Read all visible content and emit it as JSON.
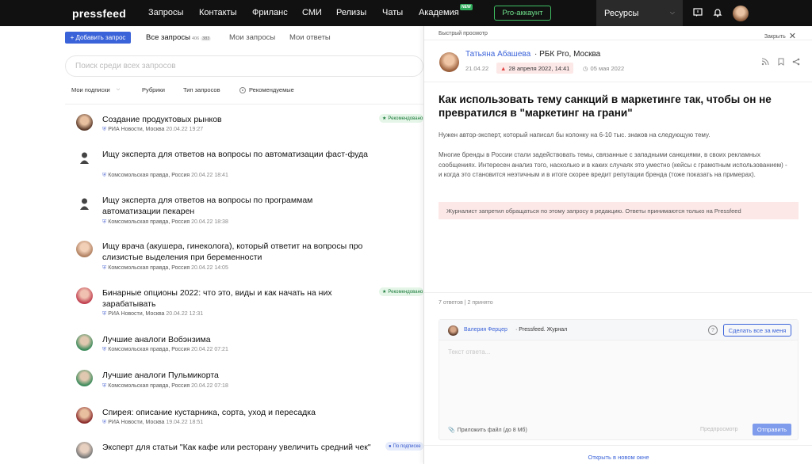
{
  "topbar": {
    "logo": "pressfeed",
    "nav": [
      "Запросы",
      "Контакты",
      "Фриланс",
      "СМИ",
      "Релизы",
      "Чаты",
      "Академия"
    ],
    "new_badge": "NEW",
    "pro_label": "Pro-аккаунт",
    "resources_label": "Ресурсы"
  },
  "left": {
    "add_button": "+ Добавить запрос",
    "tabs": [
      {
        "label": "Все запросы",
        "count_a": "406",
        "count_b": "383"
      },
      {
        "label": "Мои запросы"
      },
      {
        "label": "Мои ответы"
      }
    ],
    "search_placeholder": "Поиск среди всех запросов",
    "filters": [
      "Мои подписки",
      "Рубрики",
      "Тип запросов",
      "Рекомендуемые"
    ],
    "items": [
      {
        "title": "Создание продуктовых рынков",
        "source": "РИА Новости, Москва",
        "date": "20.04.22 19:27",
        "badge": "Рекомендовано"
      },
      {
        "title": "Ищу эксперта для ответов на вопросы по автоматизации фаст-фуда",
        "source": "Комсомольская правда, Россия",
        "date": "20.04.22 18:41"
      },
      {
        "title": "Ищу эксперта для ответов на вопросы по программам автоматизации пекарен",
        "source": "Комсомольская правда, Россия",
        "date": "20.04.22 18:38"
      },
      {
        "title": "Ищу врача (акушера, гинеколога), который ответит на вопросы про слизистые выделения при беременности",
        "source": "Комсомольская правда, Россия",
        "date": "20.04.22 14:05"
      },
      {
        "title": "Бинарные опционы 2022: что это, виды и как начать на них зарабатывать",
        "source": "РИА Новости, Москва",
        "date": "20.04.22 12:31",
        "badge": "Рекомендовано"
      },
      {
        "title": "Лучшие аналоги Вобэнзима",
        "source": "Комсомольская правда, Россия",
        "date": "20.04.22 07:21"
      },
      {
        "title": "Лучшие аналоги Пульмикорта",
        "source": "Комсомольская правда, Россия",
        "date": "20.04.22 07:18"
      },
      {
        "title": "Спирея: описание кустарника, сорта, уход и пересадка",
        "source": "РИА Новости, Москва",
        "date": "19.04.22 18:51"
      },
      {
        "title": "Эксперт для статьи \"Как кафе или ресторану увеличить средний чек\"",
        "source": "",
        "date": "",
        "pending": "По подписке"
      }
    ]
  },
  "panel": {
    "quick_view": "Быстрый просмотр",
    "close": "Закрыть",
    "author_name": "Татьяна Абашева",
    "author_org": "· РБК Pro, Москва",
    "created": "21.04.22",
    "deadline": "28 апреля 2022, 14:41",
    "publish": "05 мая 2022",
    "title": "Как использовать тему санкций в маркетинге так, чтобы он не превратился в \"маркетинг на грани\"",
    "p1": "Нужен автор-эксперт, который написал бы колонку на 6-10 тыс. знаков на следующую тему.",
    "p2": "Многие бренды в России стали задействовать темы, связанные с западными санкциями, в своих рекламных сообщениях. Интересен анализ того, насколько и в каких случаях это уместно (кейсы с грамотным использованием) - и когда это становится неэтичным и в итоге скорее вредит репутации бренда (тоже показать на примерах).",
    "warning": "Журналист запретил обращаться по этому запросу в редакцию. Ответы принимаются только на Pressfeed",
    "answers": "7 ответов | 2 принято",
    "reply": {
      "name": "Валерия Ферцер",
      "org": "· Pressfeed. Журнал",
      "make_mine": "Сделать все за меня",
      "placeholder": "Текст ответа...",
      "attach": "Приложить файл (до 8 Мб)",
      "preview": "Предпросмотр",
      "send": "Отправить"
    },
    "open_new": "Открыть в новом окне"
  }
}
